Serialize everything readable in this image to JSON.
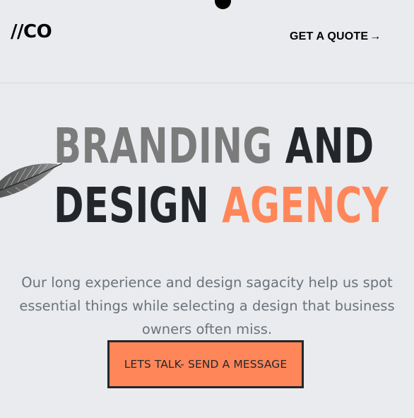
{
  "header": {
    "logo_text": "//CO",
    "quote_label": "GET A QUOTE",
    "quote_arrow": "→"
  },
  "hero": {
    "title_line1_word1": "BRANDING",
    "title_line1_word2": "AND",
    "title_line2_word1": "DESIGN",
    "title_line2_word2": "AGENCY",
    "description": "Our long experience and design sagacity help us spot essential things while selecting a design that business owners often miss.",
    "cta_label": "LETS TALK- SEND A MESSAGE"
  },
  "colors": {
    "background": "#e9ebee",
    "accent": "#ff8659",
    "gray_text": "#7b7b7b",
    "dark_text": "#23272b",
    "body_text": "#6b737a"
  },
  "icons": {
    "quote_arrow": "arrow-right-icon",
    "feather": "feather-icon",
    "top_dot": "dot-icon"
  }
}
